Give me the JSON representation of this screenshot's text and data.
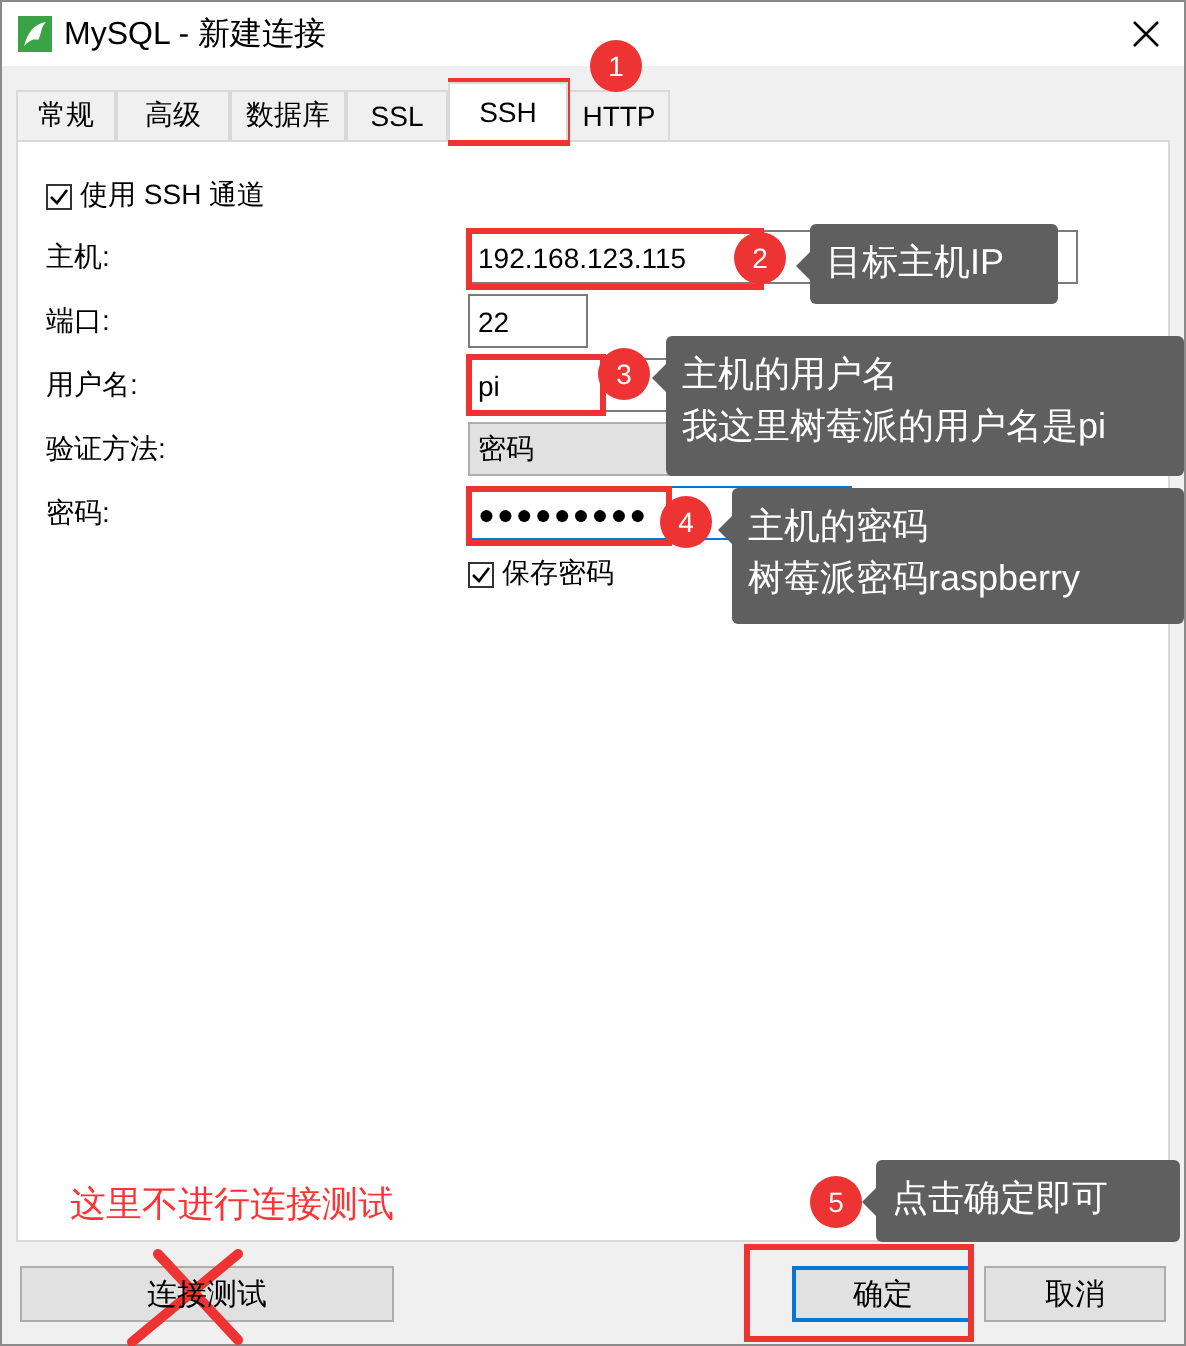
{
  "window": {
    "title": "MySQL - 新建连接"
  },
  "tabs": [
    {
      "label": "常规",
      "selected": false
    },
    {
      "label": "高级",
      "selected": false
    },
    {
      "label": "数据库",
      "selected": false
    },
    {
      "label": "SSL",
      "selected": false
    },
    {
      "label": "SSH",
      "selected": true
    },
    {
      "label": "HTTP",
      "selected": false
    }
  ],
  "ssh": {
    "use_tunnel": {
      "label": "使用 SSH 通道",
      "checked": true
    },
    "fields": [
      {
        "label": "主机:",
        "value": "192.168.123.115",
        "kind": "text"
      },
      {
        "label": "端口:",
        "value": "22",
        "kind": "text"
      },
      {
        "label": "用户名:",
        "value": "pi",
        "kind": "text"
      },
      {
        "label": "验证方法:",
        "value": "密码",
        "kind": "select"
      },
      {
        "label": "密码:",
        "value": "●●●●●●●●●",
        "kind": "password"
      }
    ],
    "save_password": {
      "label": "保存密码",
      "checked": true
    }
  },
  "buttons": [
    {
      "label": "连接测试",
      "default": false
    },
    {
      "label": "确定",
      "default": true
    },
    {
      "label": "取消",
      "default": false
    }
  ],
  "annotations": {
    "note": "这里不进行连接测试",
    "steps": [
      {
        "number": "1"
      },
      {
        "number": "2",
        "lines": [
          "目标主机IP"
        ]
      },
      {
        "number": "3",
        "lines": [
          "主机的用户名",
          "我这里树莓派的用户名是pi"
        ]
      },
      {
        "number": "4",
        "lines": [
          "主机的密码",
          "树莓派密码raspberry"
        ]
      },
      {
        "number": "5",
        "lines": [
          "点击确定即可"
        ]
      }
    ]
  }
}
